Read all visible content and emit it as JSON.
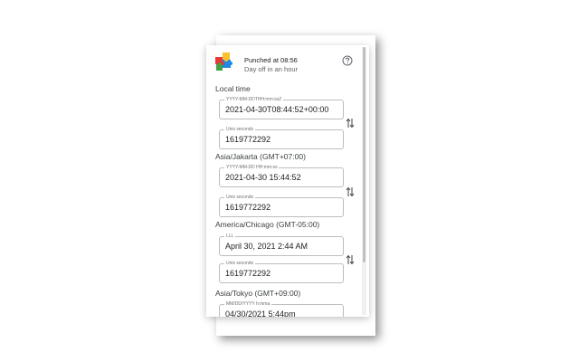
{
  "header": {
    "status_title": "Punched at 08:56",
    "status_subtitle": "Day off in an hour",
    "logo_icon": "puzzle-logo-icon",
    "help_icon": "help-circle-icon"
  },
  "sections": [
    {
      "title": "Local time",
      "fields": [
        {
          "label": "YYYY-MM-DDTHH:mm:ssZ",
          "value": "2021-04-30T08:44:52+00:00"
        },
        {
          "label": "Unix seconds",
          "value": "1619772292"
        }
      ]
    },
    {
      "title": "Asia/Jakarta (GMT+07:00)",
      "fields": [
        {
          "label": "YYYY-MM-DD HH:mm:ss",
          "value": "2021-04-30 15:44:52"
        },
        {
          "label": "Unix seconds",
          "value": "1619772292"
        }
      ]
    },
    {
      "title": "America/Chicago (GMT-05:00)",
      "fields": [
        {
          "label": "LLL",
          "value": "April 30, 2021 2:44 AM"
        },
        {
          "label": "Unix seconds",
          "value": "1619772292"
        }
      ]
    },
    {
      "title": "Asia/Tokyo (GMT+09:00)",
      "fields": [
        {
          "label": "MM/DD/YYYY h:mma",
          "value": "04/30/2021 5:44pm"
        }
      ]
    }
  ],
  "icons": {
    "swap": "swap-vertical-icon"
  },
  "colors": {
    "text": "#202124",
    "border": "#bdbdbd",
    "scroll_thumb": "#c1c1c1"
  }
}
